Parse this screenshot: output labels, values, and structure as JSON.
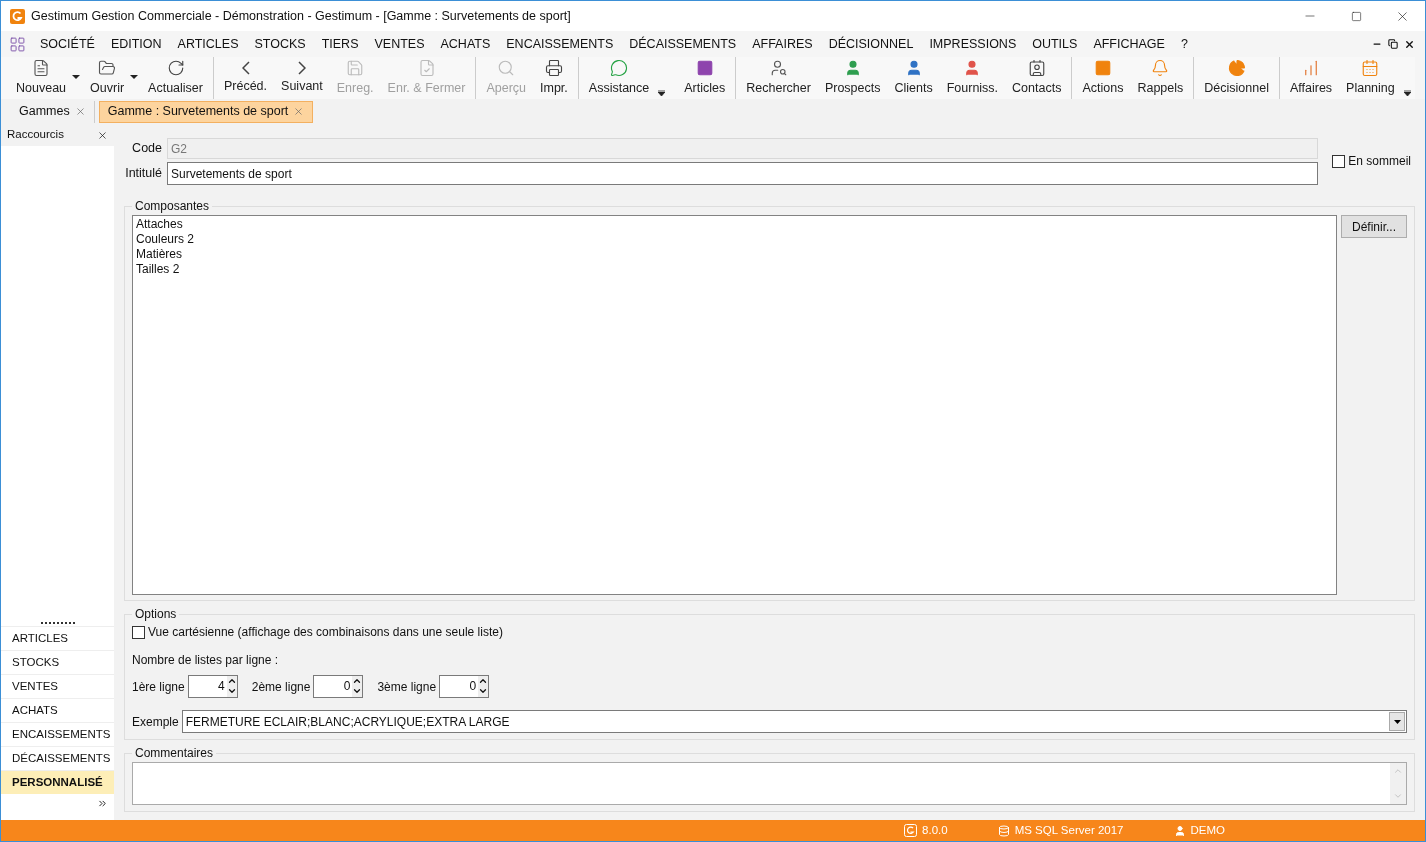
{
  "window": {
    "title": "Gestimum Gestion Commerciale - Démonstration - Gestimum - [Gamme : Survetements de sport]"
  },
  "menu": [
    "SOCIÉTÉ",
    "EDITION",
    "ARTICLES",
    "STOCKS",
    "TIERS",
    "VENTES",
    "ACHATS",
    "ENCAISSEMENTS",
    "DÉCAISSEMENTS",
    "AFFAIRES",
    "DÉCISIONNEL",
    "IMPRESSIONS",
    "OUTILS",
    "AFFICHAGE",
    "?"
  ],
  "toolbars": [
    {
      "groups": [
        [
          {
            "label": "Nouveau",
            "disabled": false,
            "dropdown": true
          },
          {
            "label": "Ouvrir",
            "disabled": false,
            "dropdown": true
          },
          {
            "label": "Actualiser",
            "disabled": false,
            "dropdown": false
          }
        ],
        [
          {
            "label": "Précéd.",
            "disabled": false,
            "dropdown": false
          },
          {
            "label": "Suivant",
            "disabled": false,
            "dropdown": false
          },
          {
            "label": "Enreg.",
            "disabled": true,
            "dropdown": false
          },
          {
            "label": "Enr. & Fermer",
            "disabled": true,
            "dropdown": false
          }
        ],
        [
          {
            "label": "Aperçu",
            "disabled": true,
            "dropdown": false
          },
          {
            "label": "Impr.",
            "disabled": false,
            "dropdown": false
          }
        ],
        [
          {
            "label": "Assistance",
            "disabled": false,
            "dropdown": false
          }
        ]
      ]
    },
    {
      "groups": [
        [
          {
            "label": "Articles",
            "disabled": false,
            "dropdown": false
          }
        ],
        [
          {
            "label": "Rechercher",
            "disabled": false,
            "dropdown": false
          },
          {
            "label": "Prospects",
            "disabled": false,
            "dropdown": false
          },
          {
            "label": "Clients",
            "disabled": false,
            "dropdown": false
          },
          {
            "label": "Fourniss.",
            "disabled": false,
            "dropdown": false
          },
          {
            "label": "Contacts",
            "disabled": false,
            "dropdown": false
          }
        ],
        [
          {
            "label": "Actions",
            "disabled": false,
            "dropdown": false
          },
          {
            "label": "Rappels",
            "disabled": false,
            "dropdown": false
          }
        ],
        [
          {
            "label": "Décisionnel",
            "disabled": false,
            "dropdown": false
          }
        ],
        [
          {
            "label": "Affaires",
            "disabled": false,
            "dropdown": false
          },
          {
            "label": "Planning",
            "disabled": false,
            "dropdown": false
          }
        ]
      ]
    }
  ],
  "tabs": [
    {
      "label": "Gammes",
      "selected": false
    },
    {
      "label": "Gamme : Survetements de sport",
      "selected": true
    }
  ],
  "sidebar": {
    "title": "Raccourcis",
    "items": [
      {
        "label": "ARTICLES",
        "selected": false
      },
      {
        "label": "STOCKS",
        "selected": false
      },
      {
        "label": "VENTES",
        "selected": false
      },
      {
        "label": "ACHATS",
        "selected": false
      },
      {
        "label": "ENCAISSEMENTS",
        "selected": false
      },
      {
        "label": "DÉCAISSEMENTS",
        "selected": false
      },
      {
        "label": "PERSONNALISÉ",
        "selected": true
      }
    ]
  },
  "form": {
    "code": {
      "label": "Code",
      "value": "G2",
      "disabled": true
    },
    "intitule": {
      "label": "Intitulé",
      "value": "Survetements de sport"
    },
    "sleep": {
      "label": "En sommeil",
      "checked": false
    },
    "components": {
      "title": "Composantes",
      "items": [
        "Attaches",
        "Couleurs 2",
        "Matières",
        "Tailles 2"
      ],
      "button": "Définir..."
    },
    "options": {
      "title": "Options",
      "cartesian": {
        "label": "Vue cartésienne (affichage des combinaisons dans une seule liste)",
        "checked": false
      },
      "count_label": "Nombre de listes par ligne :",
      "spinners": [
        {
          "label": "1ère ligne",
          "value": "4"
        },
        {
          "label": "2ème ligne",
          "value": "0"
        },
        {
          "label": "3ème ligne",
          "value": "0"
        }
      ],
      "example": {
        "label": "Exemple",
        "value": "FERMETURE ECLAIR;BLANC;ACRYLIQUE;EXTRA LARGE"
      }
    },
    "comments": {
      "title": "Commentaires"
    }
  },
  "status_bar": {
    "version": "8.0.0",
    "database": "MS SQL Server 2017",
    "user": "DEMO"
  }
}
